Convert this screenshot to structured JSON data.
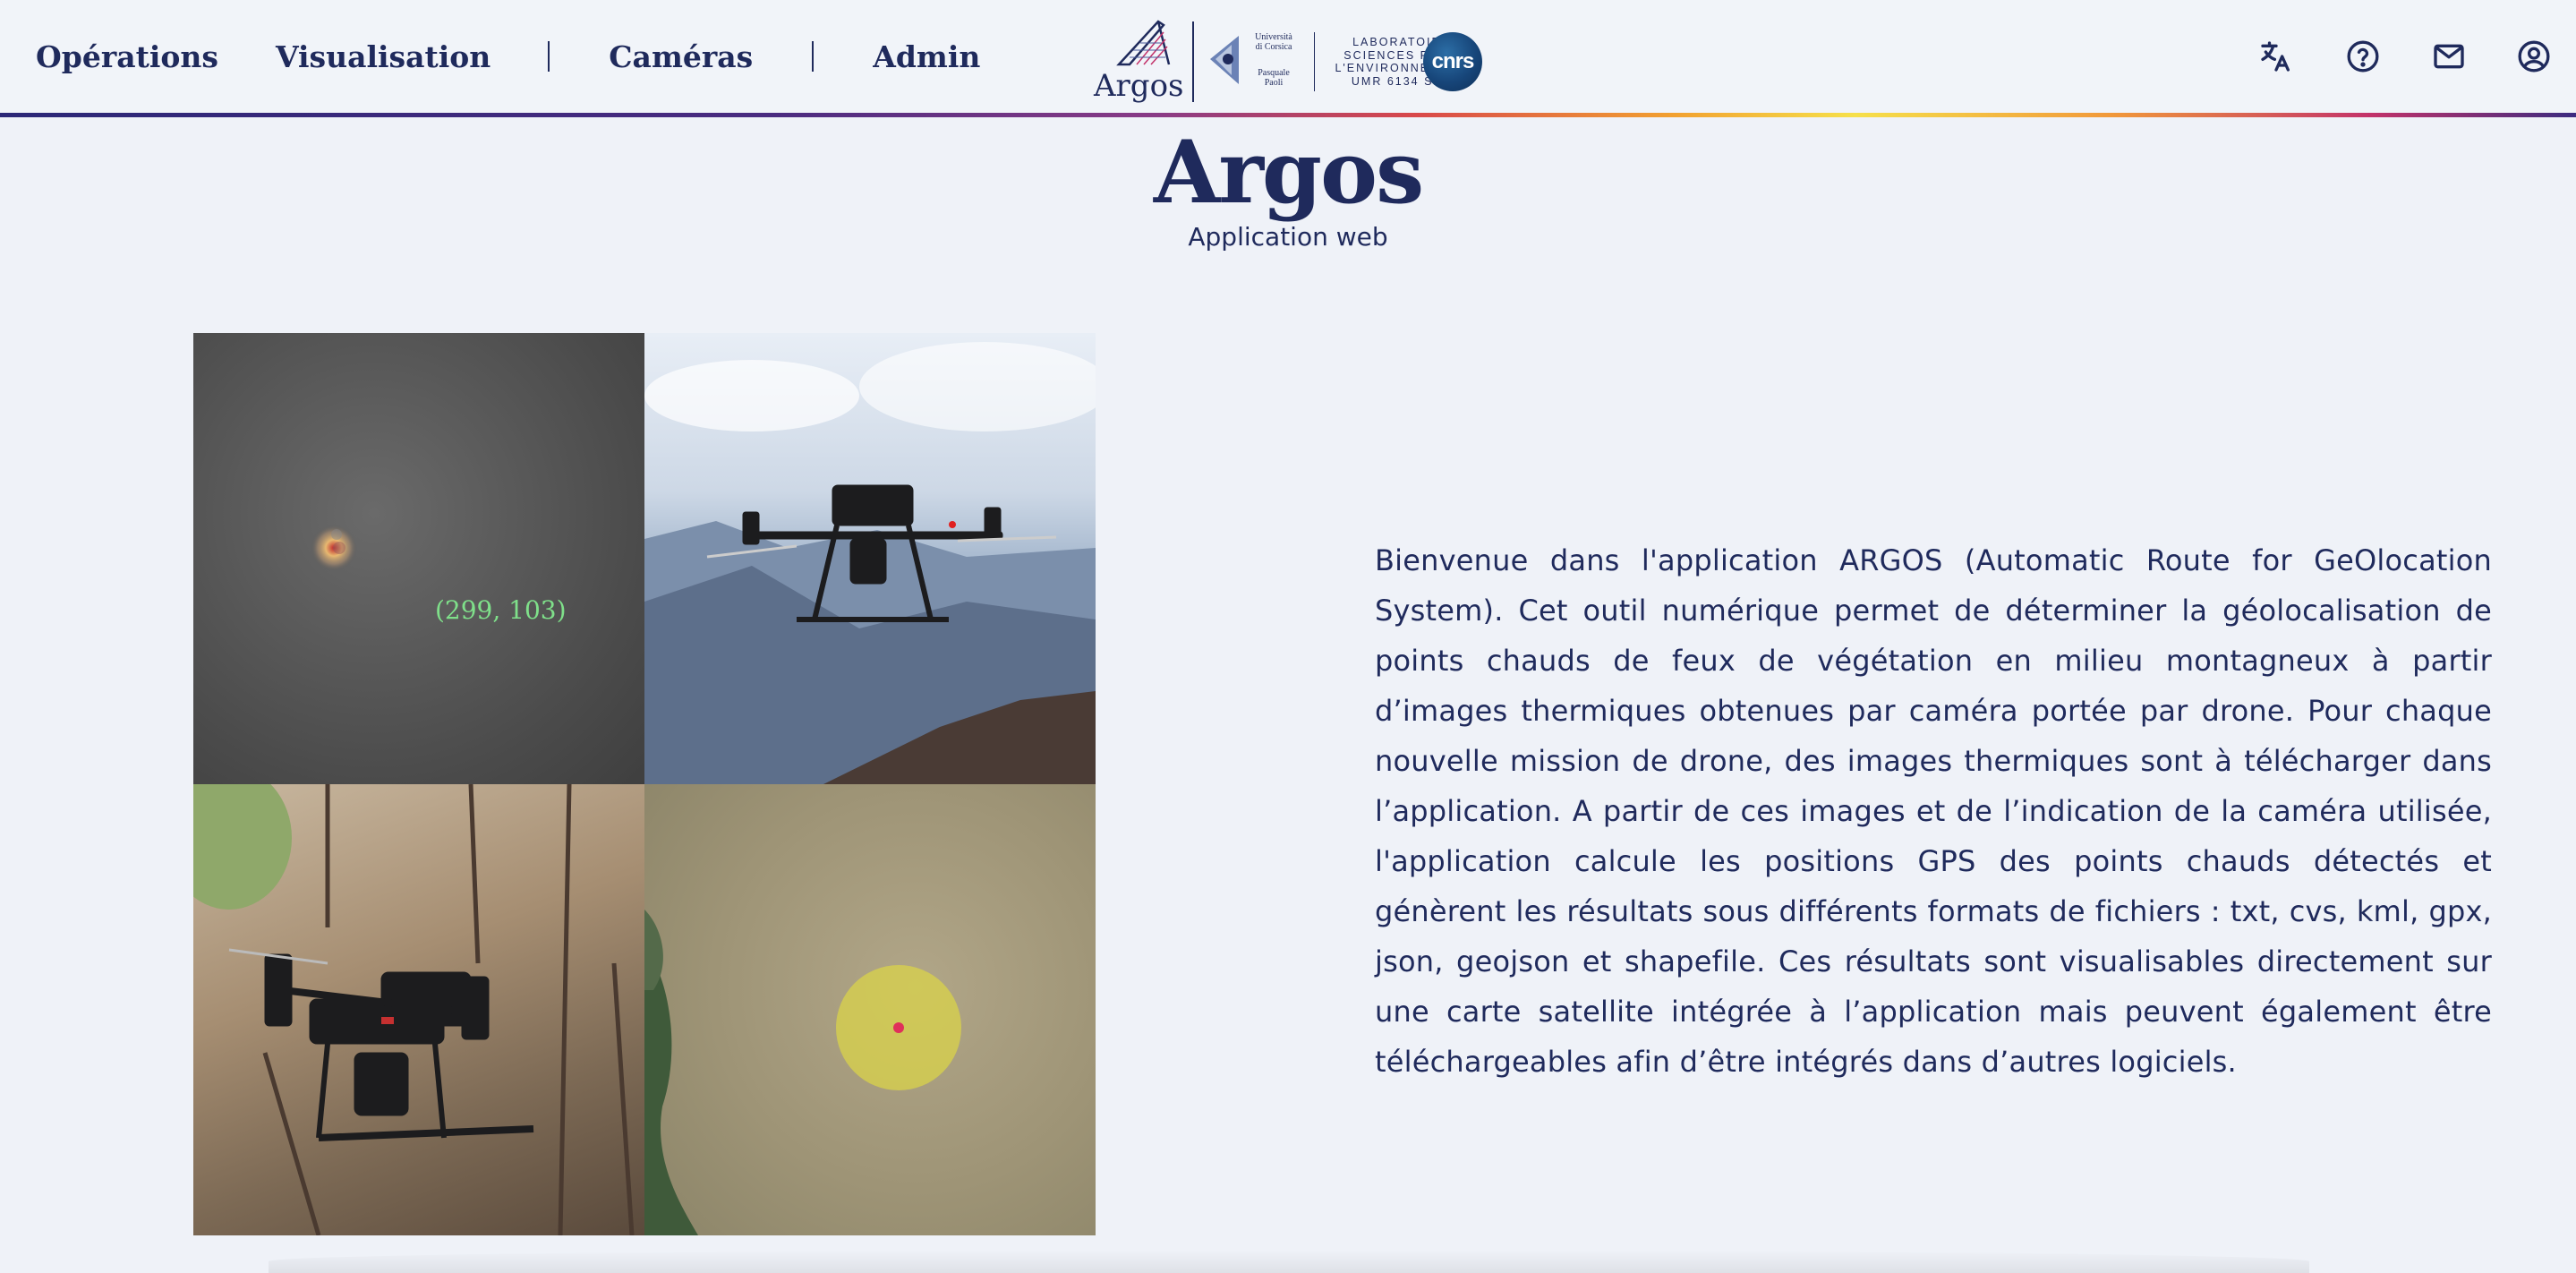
{
  "nav": {
    "items": [
      {
        "label": "Opérations"
      },
      {
        "label": "Visualisation"
      },
      {
        "label": "Caméras"
      },
      {
        "label": "Admin"
      }
    ],
    "logo_text": "Argos",
    "university_lines": [
      "Università",
      "di Corsica",
      "Pasquale",
      "Paoli"
    ],
    "lab_lines": [
      "LABORATOIRE",
      "SCIENCES POUR",
      "L'ENVIRONNEMENT",
      "UMR 6134 SPE"
    ],
    "cnrs_text": "cnrs",
    "icons": [
      "translate-icon",
      "help-icon",
      "mail-icon",
      "account-icon"
    ],
    "gradient_colors": [
      "#2b2777",
      "#d9484a",
      "#f6e04a",
      "#c3326a"
    ]
  },
  "hero": {
    "title": "Argos",
    "subtitle": "Application web"
  },
  "images": {
    "thermal_coordinate": "(299, 103)"
  },
  "description": "Bienvenue dans l'application ARGOS (Automatic Route for GeOlocation System). Cet outil numérique permet de déterminer la géolocalisation de points chauds de feux de végétation en milieu montagneux à partir d’images thermiques obtenues par caméra portée par drone. Pour chaque nouvelle mission de drone, des images thermiques sont à télécharger dans l’application. A partir de ces images et de l’indication de la caméra utilisée, l'application calcule les positions GPS des points chauds détectés et génèrent les résultats sous différents formats de fichiers : txt, cvs, kml, gpx, json, geojson et shapefile. Ces résultats sont visualisables directement sur une carte satellite intégrée à l’application mais peuvent également être téléchargeables afin d’être intégrés dans d’autres logiciels."
}
